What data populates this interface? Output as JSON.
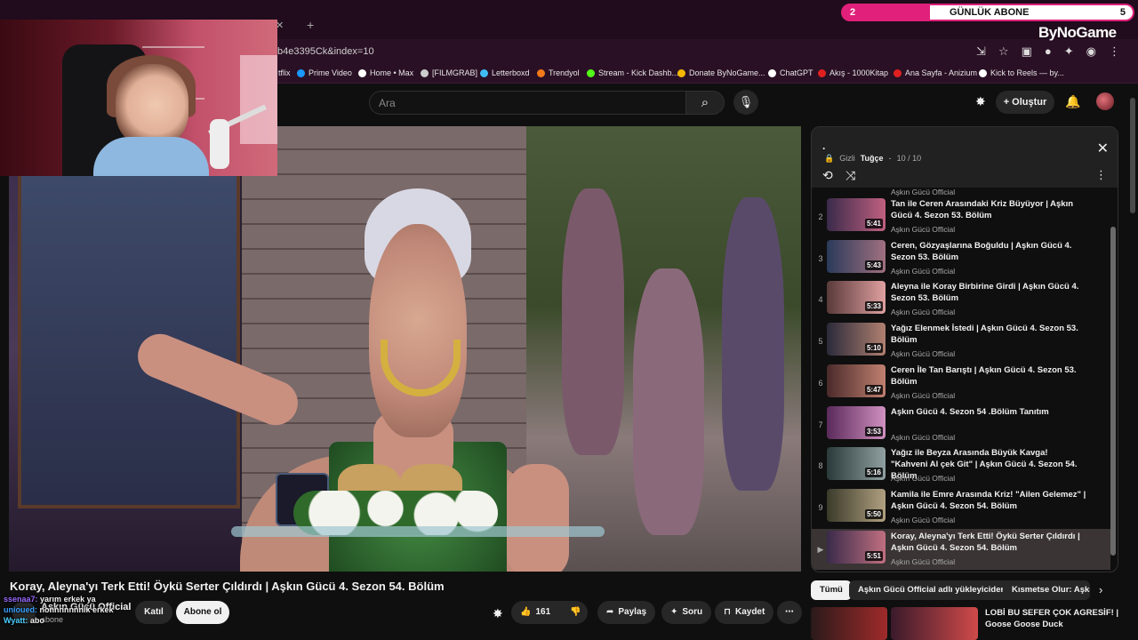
{
  "browser": {
    "url": "b4e3395Ck&index=10",
    "bookmarks": [
      {
        "label": "tflix",
        "color": "#e50914"
      },
      {
        "label": "Prime Video",
        "color": "#1a98ff"
      },
      {
        "label": "Home • Max",
        "color": "#ffffff"
      },
      {
        "label": "[FILMGRAB]",
        "color": "#cccccc"
      },
      {
        "label": "Letterboxd",
        "color": "#40bcf4"
      },
      {
        "label": "Trendyol",
        "color": "#f27a1a"
      },
      {
        "label": "Stream - Kick Dashb...",
        "color": "#53fc18"
      },
      {
        "label": "Donate ByNoGame...",
        "color": "#f5b800"
      },
      {
        "label": "ChatGPT",
        "color": "#ffffff"
      },
      {
        "label": "Akış - 1000Kitap",
        "color": "#e02020"
      },
      {
        "label": "Ana Sayfa - Anizium",
        "color": "#e02020"
      },
      {
        "label": "Kick to Reels — by...",
        "color": "#ffffff"
      }
    ]
  },
  "overlay": {
    "sub_left": "2",
    "sub_label": "GÜNLÜK ABONE",
    "sub_right": "5",
    "brand": "ByNoGame"
  },
  "youtube": {
    "search_placeholder": "Ara",
    "create_label": "+ Oluştur"
  },
  "video": {
    "title": "Koray, Aleyna'yı Terk Etti! Öykü Serter Çıldırdı | Aşkın Gücü 4. Sezon 54. Bölüm",
    "channel": "Aşkın Gücü Official",
    "subs": "abone",
    "join_label": "Katıl",
    "subscribe_label": "Abone ol",
    "likes": "161",
    "share_label": "Paylaş",
    "ask_label": "Soru",
    "save_label": "Kaydet"
  },
  "chat": [
    {
      "user": "ssenaa7:",
      "msg": "yarım erkek ya"
    },
    {
      "user": "unioued:",
      "msg": "nonnnnnnnik erkek"
    },
    {
      "user": "Wyatt:",
      "msg": "abo"
    }
  ],
  "playlist": {
    "title": ".",
    "privacy": "Gizli",
    "owner": "Tuğçe",
    "position": "10 / 10",
    "prev_channel": "Aşkın Gücü Official",
    "items": [
      {
        "idx": "2",
        "title": "Tan ile Ceren Arasındaki Kriz Büyüyor | Aşkın Gücü 4. Sezon 53. Bölüm",
        "channel": "Aşkın Gücü Official",
        "duration": "5:41",
        "c1": "#3a2a4a",
        "c2": "#c06080"
      },
      {
        "idx": "3",
        "title": "Ceren, Gözyaşlarına Boğuldu | Aşkın Gücü 4. Sezon 53. Bölüm",
        "channel": "Aşkın Gücü Official",
        "duration": "5:43",
        "c1": "#2a3a5a",
        "c2": "#a07080"
      },
      {
        "idx": "4",
        "title": "Aleyna ile Koray Birbirine Girdi | Aşkın Gücü 4. Sezon 53. Bölüm",
        "channel": "Aşkın Gücü Official",
        "duration": "5:33",
        "c1": "#5a3a3a",
        "c2": "#e0a0a0"
      },
      {
        "idx": "5",
        "title": "Yağız Elenmek İstedi | Aşkın Gücü 4. Sezon 53. Bölüm",
        "channel": "Aşkın Gücü Official",
        "duration": "5:10",
        "c1": "#2a2a3a",
        "c2": "#b08070"
      },
      {
        "idx": "6",
        "title": "Ceren İle Tan Barıştı | Aşkın Gücü 4. Sezon 53. Bölüm",
        "channel": "Aşkın Gücü Official",
        "duration": "5:47",
        "c1": "#4a2a2a",
        "c2": "#c08070"
      },
      {
        "idx": "7",
        "title": "Aşkın Gücü 4. Sezon 54 .Bölüm Tanıtım",
        "channel": "Aşkın Gücü Official",
        "duration": "3:53",
        "c1": "#5a2a5a",
        "c2": "#d090c0"
      },
      {
        "idx": "8",
        "title": "Yağız ile Beyza Arasında Büyük Kavga! \"Kahveni Al çek Git\" | Aşkın Gücü 4. Sezon 54. Bölüm",
        "channel": "Aşkın Gücü Official",
        "duration": "5:16",
        "c1": "#2a3a3a",
        "c2": "#90a0a0"
      },
      {
        "idx": "9",
        "title": "Kamila ile Emre Arasında Kriz! \"Ailen Gelemez\" | Aşkın Gücü 4. Sezon 54. Bölüm",
        "channel": "Aşkın Gücü Official",
        "duration": "5:50",
        "c1": "#3a3a2a",
        "c2": "#b0a080"
      },
      {
        "idx": "▶",
        "title": "Koray, Aleyna'yı Terk Etti! Öykü Serter Çıldırdı | Aşkın Gücü 4. Sezon 54. Bölüm",
        "channel": "Aşkın Gücü Official",
        "duration": "5:51",
        "c1": "#3a2a4a",
        "c2": "#c07080",
        "active": true
      }
    ]
  },
  "chips": [
    "Tümü",
    "Aşkın Gücü Official adlı yükleyiciden",
    "Kısmetse Olur: Aşkın"
  ],
  "recommendation": {
    "title": "LOBİ BU SEFER ÇOK AGRESİF! | Goose Goose Duck"
  }
}
